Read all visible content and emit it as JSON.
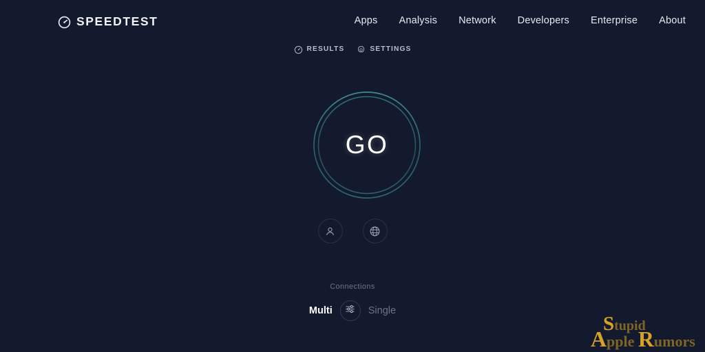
{
  "page": {
    "background_color": "#141a2d",
    "accent_color": "#2f6f7a",
    "watermark_color": "#d8a227"
  },
  "header": {
    "brand": {
      "name": "SPEEDTEST",
      "icon": "speedometer-icon"
    },
    "nav": [
      {
        "label": "Apps"
      },
      {
        "label": "Analysis"
      },
      {
        "label": "Network"
      },
      {
        "label": "Developers"
      },
      {
        "label": "Enterprise"
      },
      {
        "label": "About"
      }
    ]
  },
  "subnav": [
    {
      "label": "RESULTS",
      "icon": "results-gauge-icon"
    },
    {
      "label": "SETTINGS",
      "icon": "gear-icon"
    }
  ],
  "main": {
    "go_button": {
      "label": "GO",
      "ring_color": "#2f6f7a"
    },
    "icon_buttons": [
      {
        "name": "user-icon",
        "title": "Account"
      },
      {
        "name": "globe-icon",
        "title": "Server"
      }
    ],
    "connections": {
      "title": "Connections",
      "options": [
        {
          "label": "Multi",
          "selected": true
        },
        {
          "label": "Single",
          "selected": false
        }
      ],
      "toggle_icon": "sliders-icon"
    }
  },
  "watermark": {
    "line1_cap": "S",
    "line1_rest": "tupid",
    "line2_cap_a": "A",
    "line2_a_rest": "pple",
    "line2_cap_r": "R",
    "line2_r_rest": "umors"
  }
}
